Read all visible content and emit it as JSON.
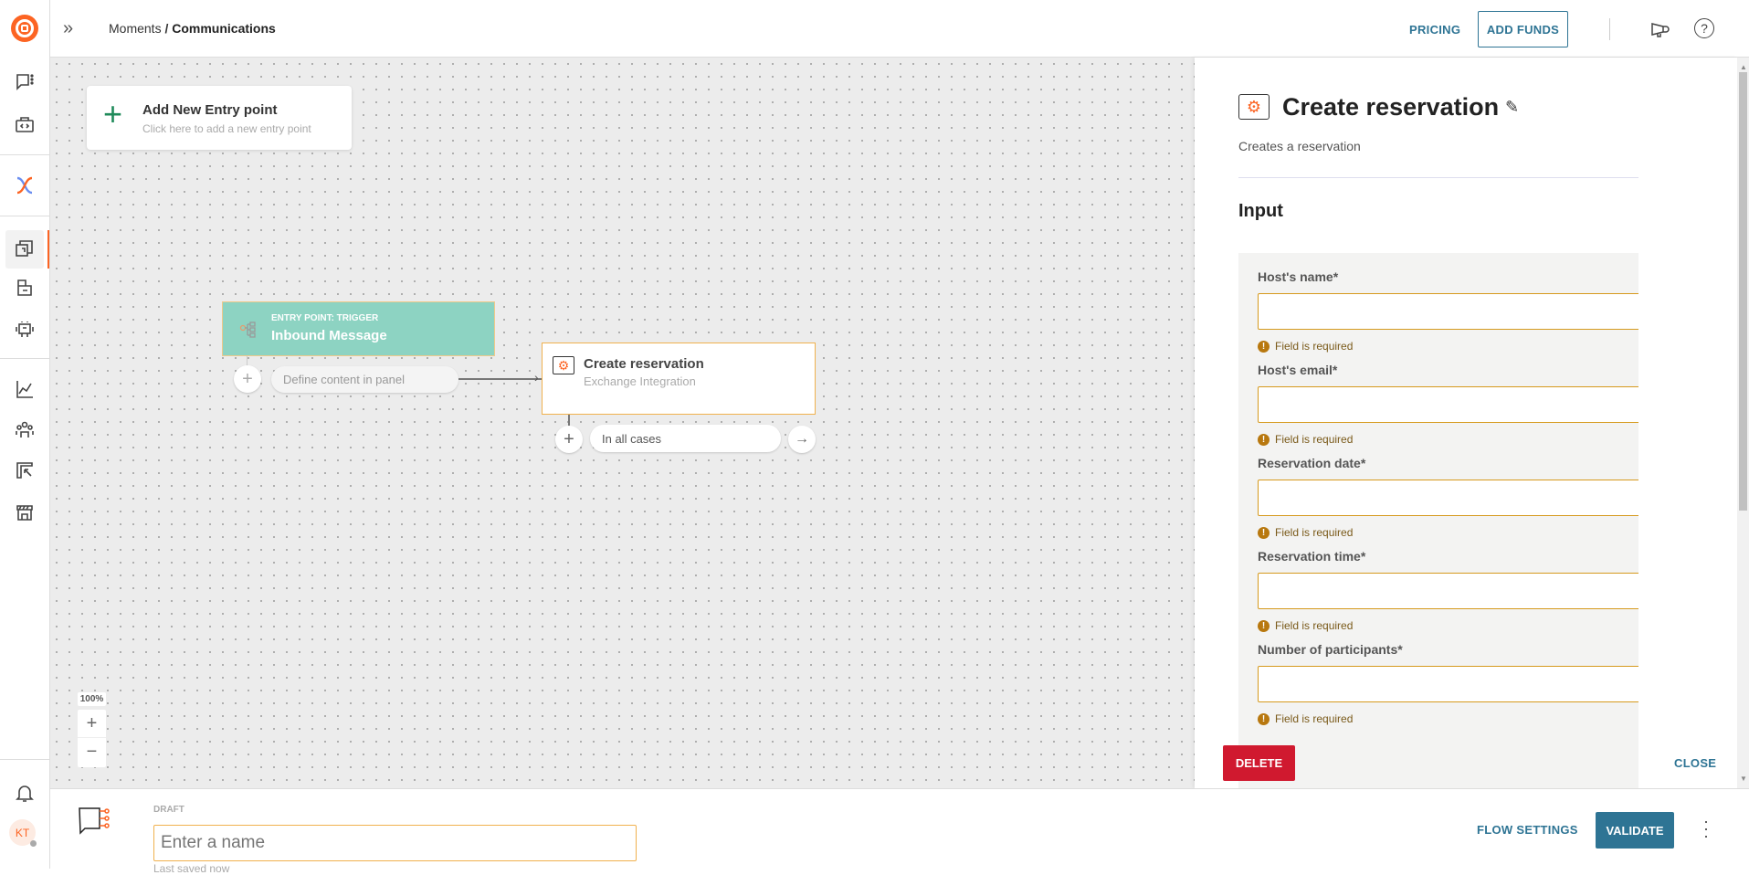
{
  "header": {
    "breadcrumb_parent": "Moments",
    "breadcrumb_sep": " / ",
    "breadcrumb_current": "Communications",
    "pricing": "PRICING",
    "add_funds": "ADD FUNDS"
  },
  "sidebar": {
    "avatar_initials": "KT",
    "active_item": "moments"
  },
  "canvas": {
    "add_entry": {
      "title": "Add New Entry point",
      "subtitle": "Click here to add a new entry point"
    },
    "trigger_node": {
      "kicker": "ENTRY POINT: TRIGGER",
      "title": "Inbound Message",
      "branch": "Define content in panel"
    },
    "action_node": {
      "title": "Create reservation",
      "subtitle": "Exchange Integration",
      "branch": "In all cases"
    },
    "zoom_level": "100%",
    "zoom_in": "+",
    "zoom_out": "−"
  },
  "panel": {
    "title": "Create reservation",
    "description": "Creates a reservation",
    "section": "Input",
    "fields": [
      {
        "label": "Host's name*",
        "value": "",
        "error": "Field is required"
      },
      {
        "label": "Host's email*",
        "value": "",
        "error": "Field is required"
      },
      {
        "label": "Reservation date*",
        "value": "",
        "error": "Field is required"
      },
      {
        "label": "Reservation time*",
        "value": "",
        "error": "Field is required"
      },
      {
        "label": "Number of participants*",
        "value": "",
        "error": "Field is required"
      }
    ],
    "variable_glyph": "{}",
    "delete": "DELETE",
    "close": "CLOSE"
  },
  "bottom": {
    "status": "DRAFT",
    "name_placeholder": "Enter a name",
    "last_saved": "Last saved now",
    "flow_settings": "FLOW SETTINGS",
    "validate": "VALIDATE"
  },
  "colors": {
    "brand": "#fc6423",
    "accent": "#2e7494",
    "delete": "#d0192f",
    "trigger": "#8dd3c2",
    "warning": "#d69a1e"
  }
}
